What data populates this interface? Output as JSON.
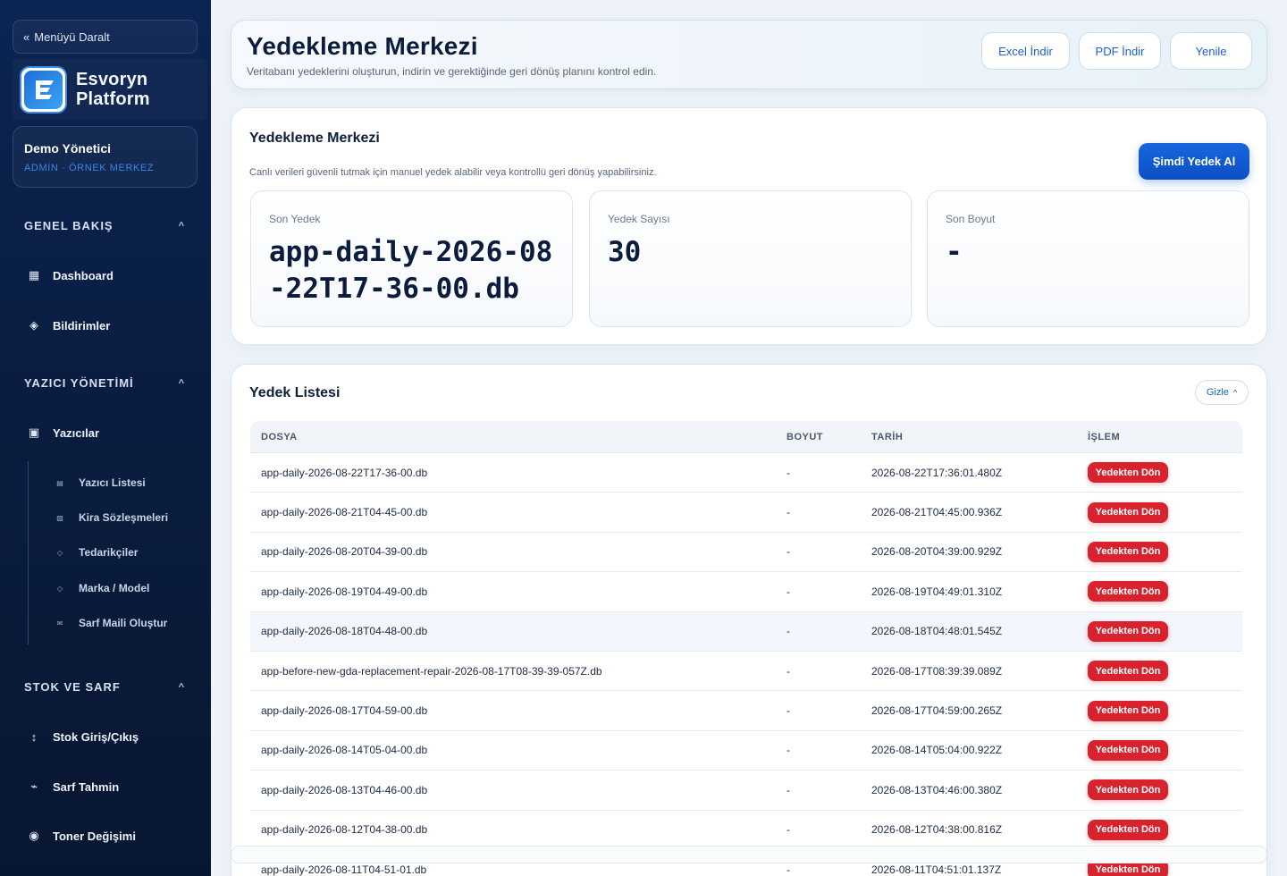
{
  "sidebar": {
    "collapse_label": "Menüyü Daralt",
    "brand_line1": "Esvoryn",
    "brand_line2": "Platform",
    "user_name": "Demo Yönetici",
    "user_role": "ADMİN · ÖRNEK MERKEZ",
    "sections": [
      {
        "title": "GENEL BAKIŞ"
      },
      {
        "title": "YAZICI YÖNETİMİ"
      },
      {
        "title": "STOK VE SARF"
      }
    ],
    "items": [
      {
        "label": "Dashboard",
        "icon": "grid-icon"
      },
      {
        "label": "Bildirimler",
        "icon": "diamond-icon"
      },
      {
        "label": "Yazıcılar",
        "icon": "printer-icon"
      },
      {
        "label": "Stok Giriş/Çıkış",
        "icon": "updown-arrow-icon"
      },
      {
        "label": "Sarf Tahmin",
        "icon": "trend-icon"
      },
      {
        "label": "Toner Değişimi",
        "icon": "circle-icon"
      }
    ],
    "sub_items": [
      {
        "label": "Yazıcı Listesi"
      },
      {
        "label": "Kira Sözleşmeleri"
      },
      {
        "label": "Tedarikçiler"
      },
      {
        "label": "Marka / Model"
      },
      {
        "label": "Sarf Maili Oluştur"
      }
    ]
  },
  "header": {
    "title": "Yedekleme Merkezi",
    "subtitle": "Veritabanı yedeklerini oluşturun, indirin ve gerektiğinde geri dönüş planını kontrol edin.",
    "buttons": {
      "excel": "Excel İndir",
      "pdf": "PDF İndir",
      "refresh": "Yenile"
    }
  },
  "backup_card": {
    "title": "Yedekleme Merkezi",
    "description": "Canlı verileri güvenli tutmak için manuel yedek alabilir veya kontrollü geri dönüş yapabilirsiniz.",
    "action": "Şimdi Yedek Al",
    "stats": [
      {
        "label": "Son Yedek",
        "value": "app-daily-2026-08-22T17-36-00.db"
      },
      {
        "label": "Yedek Sayısı",
        "value": "30"
      },
      {
        "label": "Son Boyut",
        "value": "-"
      }
    ]
  },
  "list_card": {
    "title": "Yedek Listesi",
    "hide_label": "Gizle",
    "columns": [
      "DOSYA",
      "BOYUT",
      "TARİH",
      "İŞLEM"
    ],
    "action_label": "Yedekten Dön",
    "rows": [
      {
        "file": "app-daily-2026-08-22T17-36-00.db",
        "size": "-",
        "date": "2026-08-22T17:36:01.480Z"
      },
      {
        "file": "app-daily-2026-08-21T04-45-00.db",
        "size": "-",
        "date": "2026-08-21T04:45:00.936Z"
      },
      {
        "file": "app-daily-2026-08-20T04-39-00.db",
        "size": "-",
        "date": "2026-08-20T04:39:00.929Z"
      },
      {
        "file": "app-daily-2026-08-19T04-49-00.db",
        "size": "-",
        "date": "2026-08-19T04:49:01.310Z"
      },
      {
        "file": "app-daily-2026-08-18T04-48-00.db",
        "size": "-",
        "date": "2026-08-18T04:48:01.545Z"
      },
      {
        "file": "app-before-new-gda-replacement-repair-2026-08-17T08-39-39-057Z.db",
        "size": "-",
        "date": "2026-08-17T08:39:39.089Z"
      },
      {
        "file": "app-daily-2026-08-17T04-59-00.db",
        "size": "-",
        "date": "2026-08-17T04:59:00.265Z"
      },
      {
        "file": "app-daily-2026-08-14T05-04-00.db",
        "size": "-",
        "date": "2026-08-14T05:04:00.922Z"
      },
      {
        "file": "app-daily-2026-08-13T04-46-00.db",
        "size": "-",
        "date": "2026-08-13T04:46:00.380Z"
      },
      {
        "file": "app-daily-2026-08-12T04-38-00.db",
        "size": "-",
        "date": "2026-08-12T04:38:00.816Z"
      },
      {
        "file": "app-daily-2026-08-11T04-51-01.db",
        "size": "-",
        "date": "2026-08-11T04:51:01.137Z"
      }
    ]
  },
  "colors": {
    "sidebar_bg": "#0b2452",
    "accent": "#1a66e0",
    "danger": "#d8232f"
  }
}
